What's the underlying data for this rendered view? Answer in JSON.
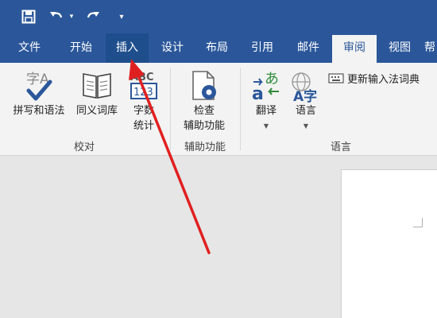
{
  "tabs": [
    {
      "label": "文件"
    },
    {
      "label": "开始"
    },
    {
      "label": "插入"
    },
    {
      "label": "设计"
    },
    {
      "label": "布局"
    },
    {
      "label": "引用"
    },
    {
      "label": "邮件"
    },
    {
      "label": "审阅"
    },
    {
      "label": "视图"
    },
    {
      "label": "帮"
    }
  ],
  "ribbon": {
    "proofing": {
      "spelling": "拼写和语法",
      "thesaurus": "同义词库",
      "word_count": [
        "字数",
        "统计"
      ],
      "group": "校对"
    },
    "accessibility": {
      "check": [
        "检查",
        "辅助功能"
      ],
      "group": "辅助功能"
    },
    "language": {
      "translate": "翻译",
      "language": "语言",
      "update_ime": "更新输入法词典",
      "group": "语言"
    }
  },
  "icons": {
    "spelling_glyph": "字A",
    "wordcount_glyph_top": "ABC",
    "wordcount_glyph_bottom": "123",
    "translate_glyph_top": "あ",
    "translate_glyph_bottom": "a",
    "language_glyph": "A字",
    "qat_customize": "▾"
  },
  "colors": {
    "title_bar": "#2b579a",
    "ribbon": "#f3f3f3",
    "annotation_arrow": "#e02020"
  }
}
